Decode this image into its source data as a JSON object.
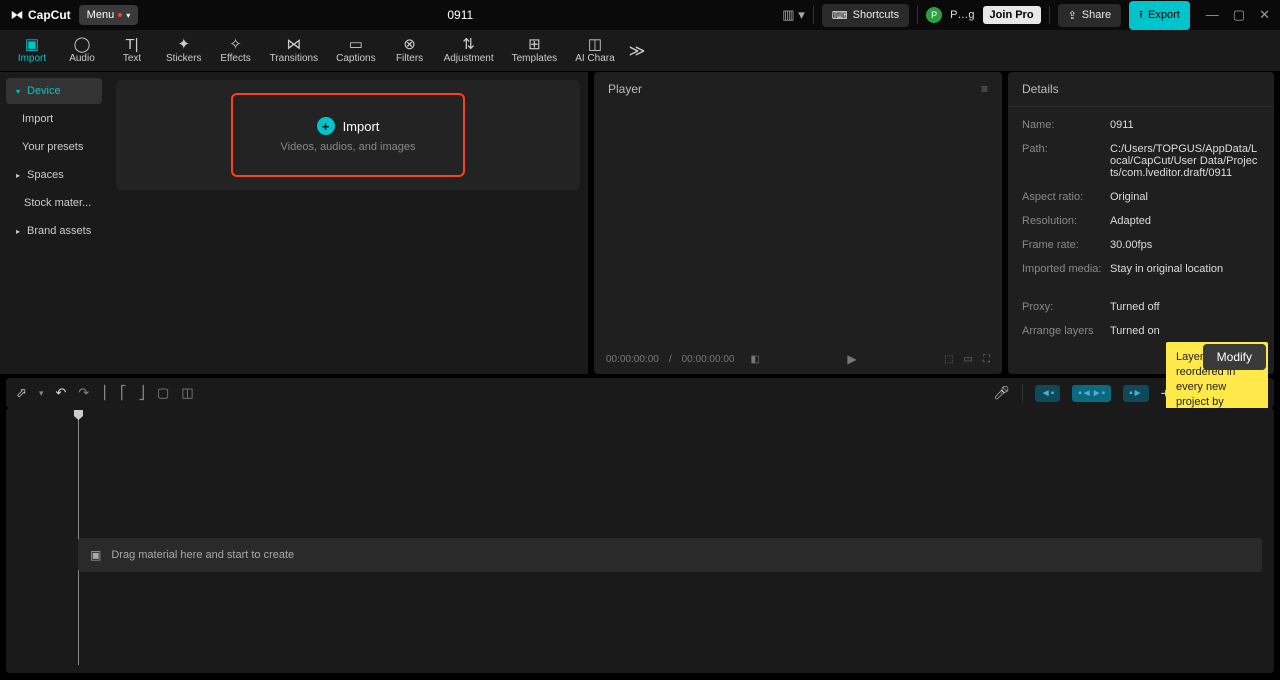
{
  "app": {
    "name": "CapCut",
    "project_title": "0911"
  },
  "titlebar": {
    "menu": "Menu",
    "shortcuts": "Shortcuts",
    "username": "P…g",
    "joinpro": "Join Pro",
    "share": "Share",
    "export": "Export"
  },
  "tabs": [
    {
      "label": "Import",
      "icon": "▣"
    },
    {
      "label": "Audio",
      "icon": "◯"
    },
    {
      "label": "Text",
      "icon": "T|"
    },
    {
      "label": "Stickers",
      "icon": "✦"
    },
    {
      "label": "Effects",
      "icon": "✧"
    },
    {
      "label": "Transitions",
      "icon": "⋈"
    },
    {
      "label": "Captions",
      "icon": "▭"
    },
    {
      "label": "Filters",
      "icon": "⊗"
    },
    {
      "label": "Adjustment",
      "icon": "⇅"
    },
    {
      "label": "Templates",
      "icon": "⊞"
    },
    {
      "label": "AI Chara",
      "icon": "◫"
    }
  ],
  "sidebar": {
    "items": [
      {
        "label": "Device",
        "active": true,
        "caret": true
      },
      {
        "label": "Import",
        "sub": true
      },
      {
        "label": "Your presets",
        "sub": true
      },
      {
        "label": "Spaces",
        "caret": true
      },
      {
        "label": "Stock mater..."
      },
      {
        "label": "Brand assets",
        "caret": true
      }
    ]
  },
  "import_area": {
    "title": "Import",
    "subtitle": "Videos, audios, and images"
  },
  "player": {
    "title": "Player",
    "time_current": "00:00:00:00",
    "time_sep": "/",
    "time_total": "00:00:00:00"
  },
  "details": {
    "title": "Details",
    "rows": [
      {
        "k": "Name:",
        "v": "0911"
      },
      {
        "k": "Path:",
        "v": "C:/Users/TOPGUS/AppData/Local/CapCut/User Data/Projects/com.lveditor.draft/0911"
      },
      {
        "k": "Aspect ratio:",
        "v": "Original"
      },
      {
        "k": "Resolution:",
        "v": "Adapted"
      },
      {
        "k": "Frame rate:",
        "v": "30.00fps"
      },
      {
        "k": "Imported media:",
        "v": "Stay in original location"
      },
      {
        "k": "Proxy:",
        "v": "Turned off"
      },
      {
        "k": "Arrange layers",
        "v": "Turned on"
      }
    ],
    "tooltip": "Layers can be reordered in every new project by default.",
    "modify": "Modify"
  },
  "timeline": {
    "hint": "Drag material here and start to create"
  }
}
